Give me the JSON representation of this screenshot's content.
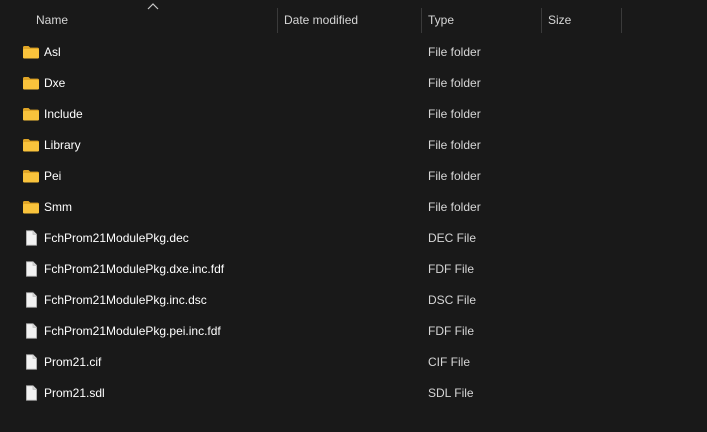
{
  "header": {
    "name": "Name",
    "date_modified": "Date modified",
    "type": "Type",
    "size": "Size"
  },
  "colors": {
    "background": "#191919",
    "text": "#ffffff",
    "folder_yellow": "#f9c33c",
    "file_white": "#f2f2f2"
  },
  "files": [
    {
      "name": "Asl",
      "type": "File folder",
      "date": "",
      "size": "",
      "icon": "folder-icon"
    },
    {
      "name": "Dxe",
      "type": "File folder",
      "date": "",
      "size": "",
      "icon": "folder-icon"
    },
    {
      "name": "Include",
      "type": "File folder",
      "date": "",
      "size": "",
      "icon": "folder-icon"
    },
    {
      "name": "Library",
      "type": "File folder",
      "date": "",
      "size": "",
      "icon": "folder-icon"
    },
    {
      "name": "Pei",
      "type": "File folder",
      "date": "",
      "size": "",
      "icon": "folder-icon"
    },
    {
      "name": "Smm",
      "type": "File folder",
      "date": "",
      "size": "",
      "icon": "folder-icon"
    },
    {
      "name": "FchProm21ModulePkg.dec",
      "type": "DEC File",
      "date": "",
      "size": "",
      "icon": "file-icon"
    },
    {
      "name": "FchProm21ModulePkg.dxe.inc.fdf",
      "type": "FDF File",
      "date": "",
      "size": "",
      "icon": "file-icon"
    },
    {
      "name": "FchProm21ModulePkg.inc.dsc",
      "type": "DSC File",
      "date": "",
      "size": "",
      "icon": "file-icon"
    },
    {
      "name": "FchProm21ModulePkg.pei.inc.fdf",
      "type": "FDF File",
      "date": "",
      "size": "",
      "icon": "file-icon"
    },
    {
      "name": "Prom21.cif",
      "type": "CIF File",
      "date": "",
      "size": "",
      "icon": "file-icon"
    },
    {
      "name": "Prom21.sdl",
      "type": "SDL File",
      "date": "",
      "size": "",
      "icon": "file-icon"
    }
  ]
}
